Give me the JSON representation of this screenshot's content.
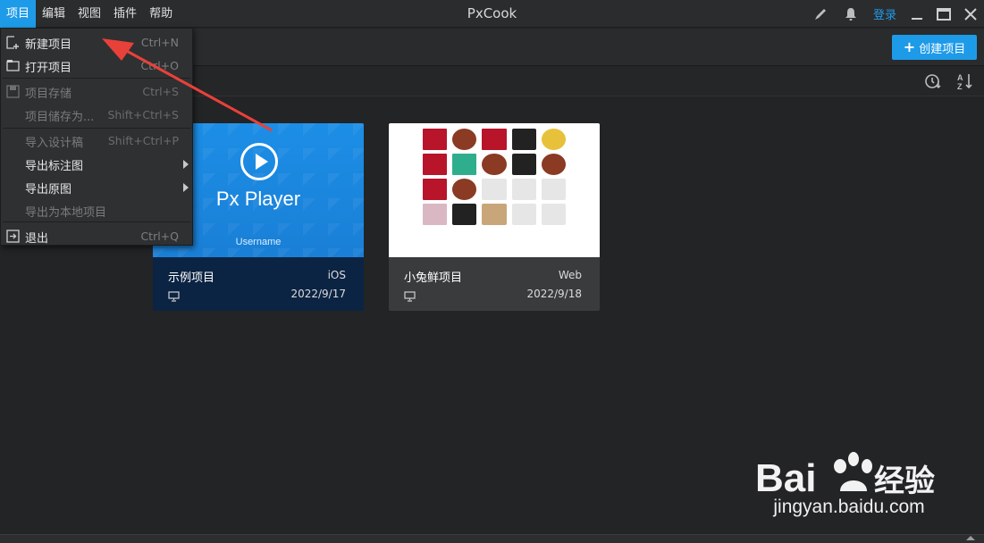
{
  "app": {
    "title": "PxCook"
  },
  "menubar": {
    "items": [
      {
        "label": "项目",
        "active": true
      },
      {
        "label": "编辑"
      },
      {
        "label": "视图"
      },
      {
        "label": "插件"
      },
      {
        "label": "帮助"
      }
    ]
  },
  "titlebar_right": {
    "icons": [
      "brush-icon",
      "bell-icon"
    ],
    "login_label": "登录",
    "window_controls": [
      "minimize-icon",
      "maximize-icon",
      "close-icon"
    ]
  },
  "toolbar": {
    "create_label": "创建项目",
    "create_icon": "plus-icon"
  },
  "sort": {
    "icons": [
      "sort-by-time-icon",
      "sort-alpha-icon"
    ]
  },
  "dropdown": {
    "items": [
      {
        "label": "新建项目",
        "shortcut": "Ctrl+N",
        "icon": "new-project-icon",
        "disabled": false
      },
      {
        "label": "打开项目",
        "shortcut": "Ctrl+O",
        "icon": "open-folder-icon",
        "disabled": false
      },
      {
        "label": "项目存储",
        "shortcut": "Ctrl+S",
        "icon": "save-icon",
        "disabled": true
      },
      {
        "label": "项目储存为...",
        "shortcut": "Shift+Ctrl+S",
        "disabled": true
      },
      {
        "label": "导入设计稿",
        "shortcut": "Shift+Ctrl+P",
        "disabled": true
      },
      {
        "label": "导出标注图",
        "submenu": true,
        "disabled": false
      },
      {
        "label": "导出原图",
        "submenu": true,
        "disabled": false
      },
      {
        "label": "导出为本地项目",
        "disabled": true
      },
      {
        "label": "退出",
        "shortcut": "Ctrl+Q",
        "icon": "exit-icon",
        "disabled": false
      }
    ]
  },
  "projects": [
    {
      "name": "示例项目",
      "platform": "iOS",
      "date": "2022/9/17",
      "thumbnail": {
        "title": "Px Player",
        "subtitle": "Username",
        "bg": "#1c8ee6"
      }
    },
    {
      "name": "小兔鲜项目",
      "platform": "Web",
      "date": "2022/9/18",
      "thumbnail": {
        "bg": "#ffffff"
      }
    }
  ],
  "watermark": {
    "text": "jingyan.baidu.com",
    "brand": "Bai du 经验"
  },
  "colors": {
    "accent": "#1e9be8",
    "annotation": "#e8413a",
    "background": "#232426"
  }
}
